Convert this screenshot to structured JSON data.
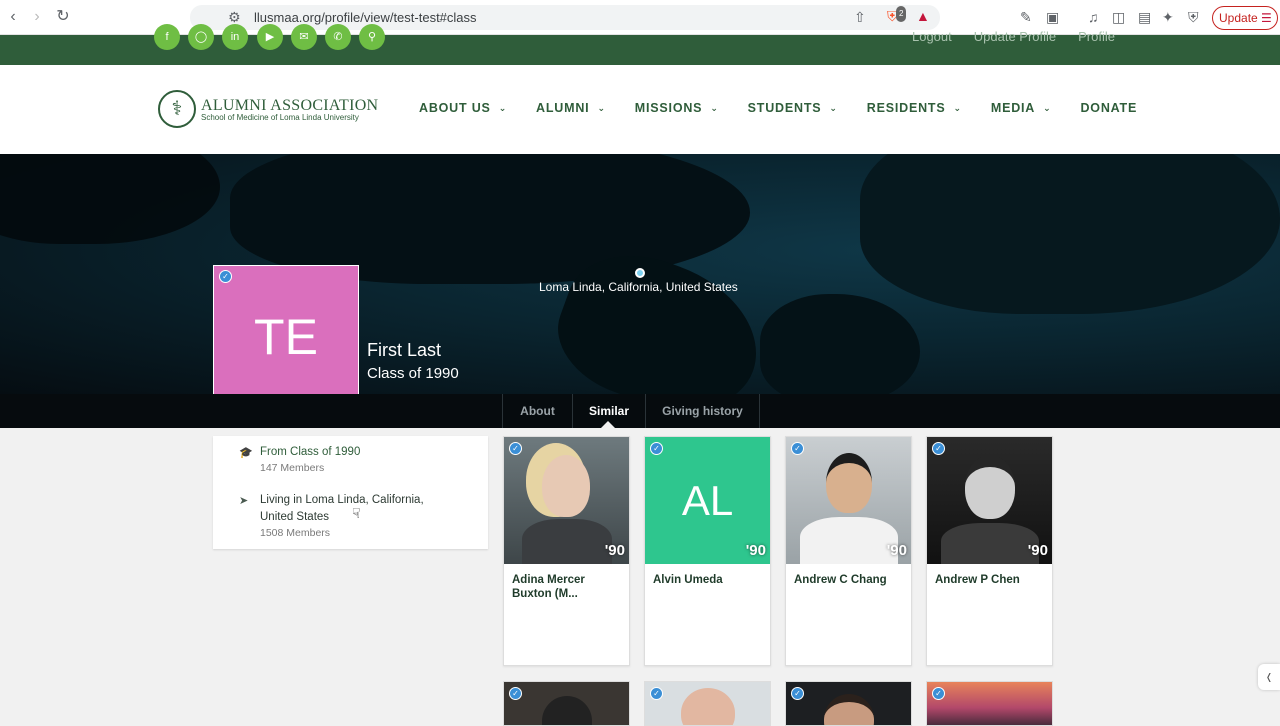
{
  "browser": {
    "url": "llusmaa.org/profile/view/test-test#class",
    "update_label": "Update",
    "badge_count": "2"
  },
  "topbar": {
    "links": [
      "Logout",
      "Update Profile",
      "Profile"
    ]
  },
  "logo": {
    "title": "ALUMNI ASSOCIATION",
    "subtitle": "School of Medicine of Loma Linda University"
  },
  "nav": {
    "items": [
      {
        "label": "ABOUT US",
        "has_menu": true
      },
      {
        "label": "ALUMNI",
        "has_menu": true
      },
      {
        "label": "MISSIONS",
        "has_menu": true
      },
      {
        "label": "STUDENTS",
        "has_menu": true
      },
      {
        "label": "RESIDENTS",
        "has_menu": true
      },
      {
        "label": "MEDIA",
        "has_menu": true
      },
      {
        "label": "DONATE",
        "has_menu": false
      }
    ]
  },
  "hero": {
    "location": "Loma Linda, California, United States",
    "initials": "TE",
    "name": "First Last",
    "class_label": "Class of 1990",
    "avatar_color": "#da6fbd"
  },
  "tabs": [
    {
      "label": "About",
      "active": false
    },
    {
      "label": "Similar",
      "active": true
    },
    {
      "label": "Giving history",
      "active": false
    }
  ],
  "filters": [
    {
      "icon": "graduation-cap-icon",
      "title": "From Class of 1990",
      "count": "147 Members"
    },
    {
      "icon": "location-arrow-icon",
      "title": "Living in Loma Linda, California, United States",
      "count": "1508 Members"
    }
  ],
  "cards": [
    {
      "name": "Adina Mercer Buxton (M...",
      "year": "'90",
      "photo": "photo"
    },
    {
      "name": "Alvin Umeda",
      "year": "'90",
      "initials": "AL",
      "color": "#2ec68e"
    },
    {
      "name": "Andrew C Chang",
      "year": "'90",
      "photo": "photo"
    },
    {
      "name": "Andrew P Chen",
      "year": "'90",
      "photo": "photo"
    }
  ],
  "colors": {
    "brand_green": "#2f5d3a",
    "accent_green": "#6fbe44",
    "verified_blue": "#3b8fd6"
  }
}
